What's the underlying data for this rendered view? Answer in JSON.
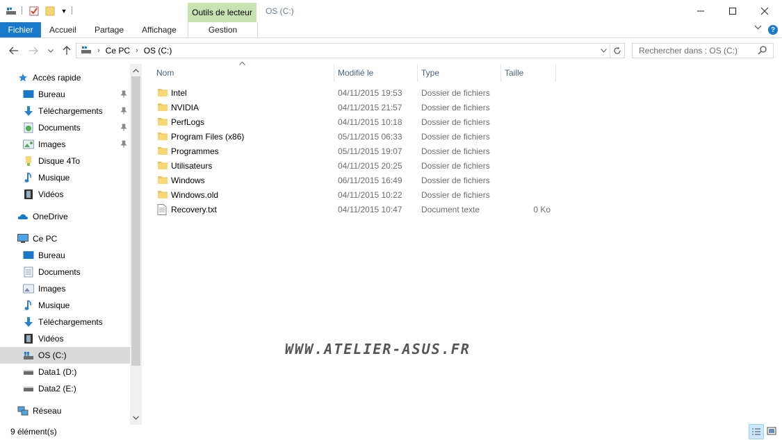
{
  "window": {
    "title": "OS (C:)",
    "contextual_tab_group": "Outils de lecteur",
    "controls": [
      "—",
      "☐",
      "✕"
    ]
  },
  "ribbon": {
    "file_tab": "Fichier",
    "tabs": [
      "Accueil",
      "Partage",
      "Affichage"
    ],
    "contextual_tab": "Gestion",
    "help": "?"
  },
  "address_bar": {
    "breadcrumb": [
      "Ce PC",
      "OS (C:)"
    ]
  },
  "search": {
    "placeholder": "Rechercher dans : OS (C:)"
  },
  "sidebar": {
    "quick_access": {
      "label": "Accès rapide",
      "items": [
        {
          "label": "Bureau",
          "icon": "desktop-icon",
          "pinned": true
        },
        {
          "label": "Téléchargements",
          "icon": "download-icon",
          "pinned": true
        },
        {
          "label": "Documents",
          "icon": "documents-icon",
          "pinned": true
        },
        {
          "label": "Images",
          "icon": "images-icon",
          "pinned": true
        },
        {
          "label": "Disque 4To",
          "icon": "folder-icon",
          "pinned": false
        },
        {
          "label": "Musique",
          "icon": "music-icon",
          "pinned": false
        },
        {
          "label": "Vidéos",
          "icon": "videos-icon",
          "pinned": false
        }
      ]
    },
    "onedrive": {
      "label": "OneDrive"
    },
    "this_pc": {
      "label": "Ce PC",
      "items": [
        {
          "label": "Bureau",
          "icon": "desktop-icon"
        },
        {
          "label": "Documents",
          "icon": "documents-icon"
        },
        {
          "label": "Images",
          "icon": "images-icon"
        },
        {
          "label": "Musique",
          "icon": "music-icon"
        },
        {
          "label": "Téléchargements",
          "icon": "download-icon"
        },
        {
          "label": "Vidéos",
          "icon": "videos-icon"
        },
        {
          "label": "OS (C:)",
          "icon": "windows-drive-icon",
          "selected": true
        },
        {
          "label": "Data1 (D:)",
          "icon": "drive-icon"
        },
        {
          "label": "Data2 (E:)",
          "icon": "drive-icon"
        }
      ]
    },
    "network": {
      "label": "Réseau"
    }
  },
  "columns": {
    "name": "Nom",
    "modified": "Modifié le",
    "type": "Type",
    "size": "Taille"
  },
  "files": [
    {
      "name": "Intel",
      "modified": "04/11/2015 19:53",
      "type": "Dossier de fichiers",
      "size": "",
      "icon": "folder-icon"
    },
    {
      "name": "NVIDIA",
      "modified": "04/11/2015 21:57",
      "type": "Dossier de fichiers",
      "size": "",
      "icon": "folder-icon"
    },
    {
      "name": "PerfLogs",
      "modified": "04/11/2015 10:18",
      "type": "Dossier de fichiers",
      "size": "",
      "icon": "folder-icon"
    },
    {
      "name": "Program Files (x86)",
      "modified": "05/11/2015 06:33",
      "type": "Dossier de fichiers",
      "size": "",
      "icon": "folder-icon"
    },
    {
      "name": "Programmes",
      "modified": "05/11/2015 19:07",
      "type": "Dossier de fichiers",
      "size": "",
      "icon": "folder-icon"
    },
    {
      "name": "Utilisateurs",
      "modified": "04/11/2015 20:25",
      "type": "Dossier de fichiers",
      "size": "",
      "icon": "folder-icon"
    },
    {
      "name": "Windows",
      "modified": "06/11/2015 16:49",
      "type": "Dossier de fichiers",
      "size": "",
      "icon": "folder-icon"
    },
    {
      "name": "Windows.old",
      "modified": "04/11/2015 10:22",
      "type": "Dossier de fichiers",
      "size": "",
      "icon": "folder-icon"
    },
    {
      "name": "Recovery.txt",
      "modified": "04/11/2015 10:47",
      "type": "Document texte",
      "size": "0 Ko",
      "icon": "text-file-icon"
    }
  ],
  "watermark": "WWW.ATELIER-ASUS.FR",
  "status_bar": {
    "item_count": "9 élément(s)"
  },
  "colors": {
    "accent": "#1979ca",
    "contextual_tab": "#c7e3b2",
    "folder": "#f8d775",
    "selection": "#d9d9d9"
  }
}
